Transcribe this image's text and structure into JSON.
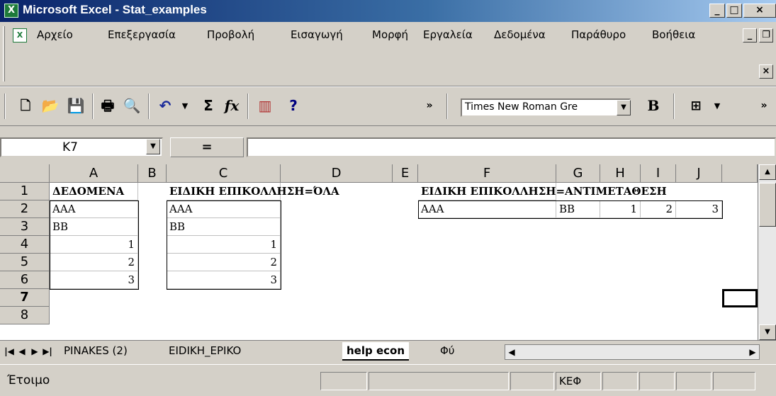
{
  "window": {
    "title": "Microsoft Excel - Stat_examples",
    "app_icon": "excel-icon"
  },
  "menu": {
    "items": [
      "Αρχείο",
      "Επεξεργασία",
      "Προβολή",
      "Εισαγωγή",
      "Μορφή",
      "Εργαλεία",
      "Δεδομένα",
      "Παράθυρο",
      "Βοήθεια"
    ]
  },
  "toolbar": {
    "font_name": "Times New Roman Gre",
    "bold_label": "B",
    "sum_label": "Σ",
    "fx_label": "fx"
  },
  "formula_bar": {
    "name_box": "K7",
    "equals_label": "=",
    "content": ""
  },
  "sheet": {
    "columns": [
      "A",
      "B",
      "C",
      "D",
      "E",
      "F",
      "G",
      "H",
      "I",
      "J"
    ],
    "rows": [
      "1",
      "2",
      "3",
      "4",
      "5",
      "6",
      "7",
      "8"
    ],
    "cells": {
      "A1": "ΔΕΔΟΜΕΝΑ",
      "C1": "ΕΙΔΙΚΗ ΕΠΙΚΟΛΛΗΣΗ=ΌΛΑ",
      "F1": "ΕΙΔΙΚΗ ΕΠΙΚΟΛΛΗΣΗ=ΑΝΤΙΜΕΤΑΘΕΣΗ",
      "A2": "AAA",
      "C2": "AAA",
      "F2": "AAA",
      "G2": "BB",
      "H2": "1",
      "I2": "2",
      "J2": "3",
      "A3": "BB",
      "C3": "BB",
      "A4": "1",
      "C4": "1",
      "A5": "2",
      "C5": "2",
      "A6": "3",
      "C6": "3"
    }
  },
  "tabs": {
    "sheets": [
      "PINAKES (2)",
      "EIDIKH_EPIKO",
      "help econ",
      "Φύ"
    ],
    "active": "help econ"
  },
  "status": {
    "text": "Έτοιμο",
    "caps": "ΚΕΦ"
  }
}
